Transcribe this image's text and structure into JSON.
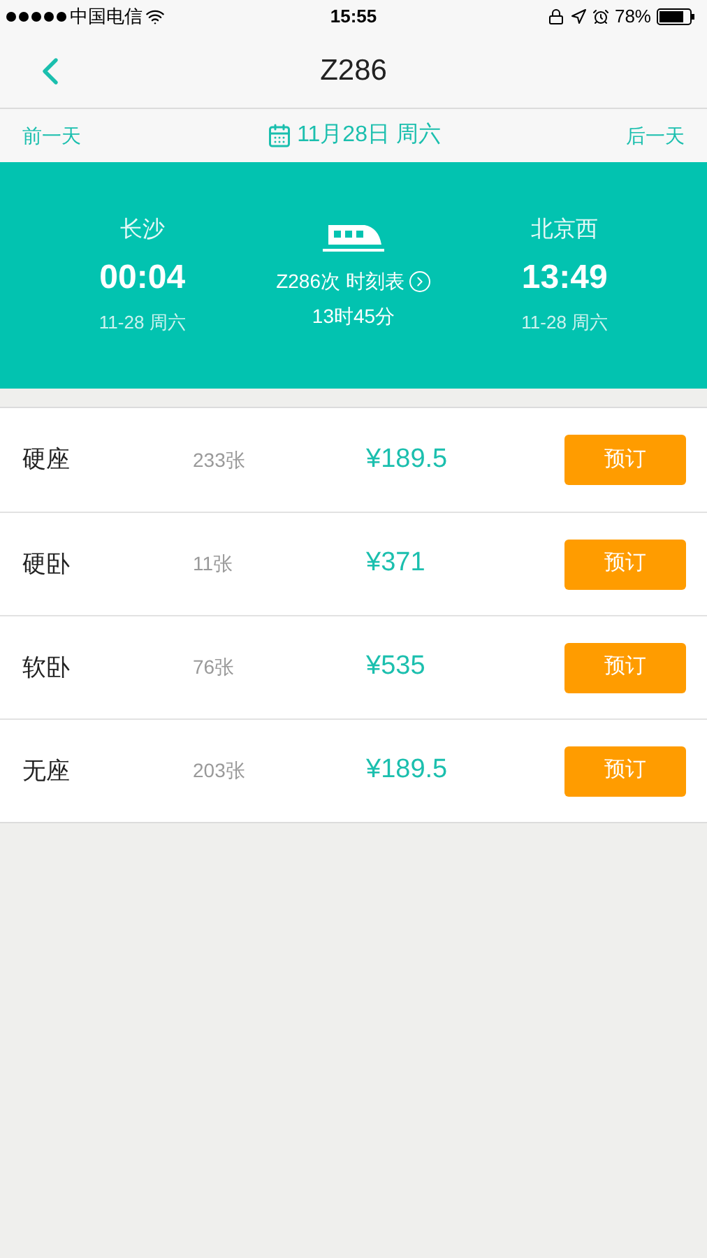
{
  "status_bar": {
    "carrier": "中国电信",
    "time": "15:55",
    "battery": "78%"
  },
  "nav": {
    "title": "Z286"
  },
  "date_bar": {
    "prev": "前一天",
    "date": "11月28日 周六",
    "next": "后一天"
  },
  "trip": {
    "from": {
      "station": "长沙",
      "time": "00:04",
      "date": "11-28 周六"
    },
    "train": "Z286次 时刻表",
    "duration": "13时45分",
    "to": {
      "station": "北京西",
      "time": "13:49",
      "date": "11-28 周六"
    }
  },
  "seats": [
    {
      "type": "硬座",
      "count": "233张",
      "price": "¥189.5",
      "button": "预订"
    },
    {
      "type": "硬卧",
      "count": "11张",
      "price": "¥371",
      "button": "预订"
    },
    {
      "type": "软卧",
      "count": "76张",
      "price": "¥535",
      "button": "预订"
    },
    {
      "type": "无座",
      "count": "203张",
      "price": "¥189.5",
      "button": "预订"
    }
  ]
}
